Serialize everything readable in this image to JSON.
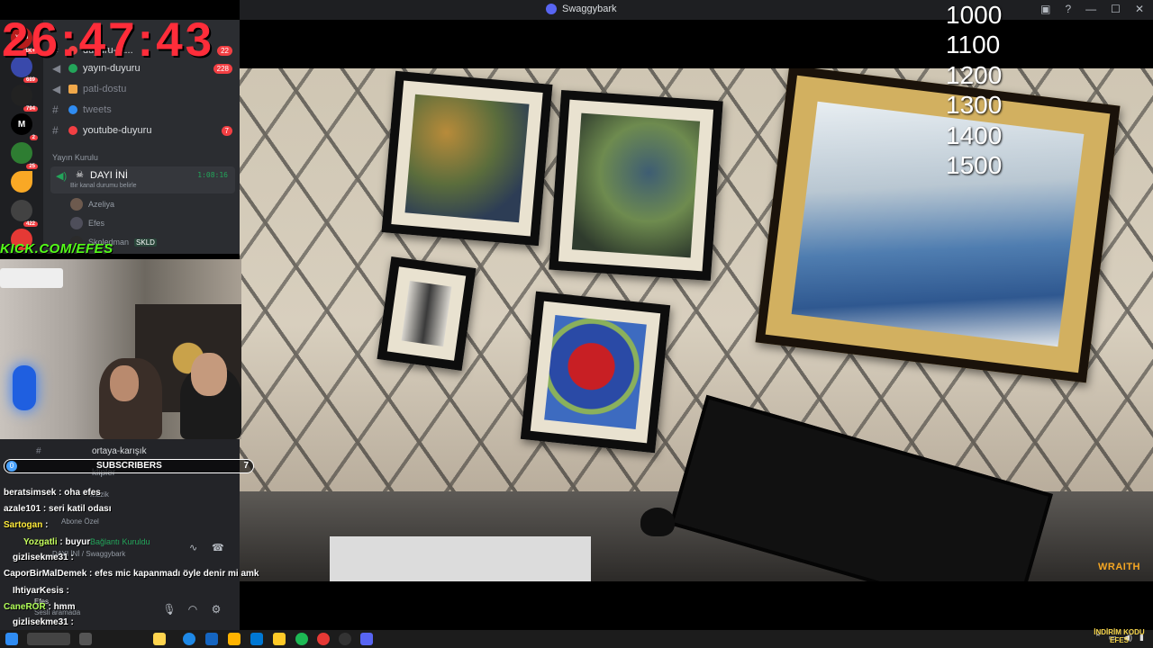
{
  "window": {
    "title": "Swaggybark"
  },
  "overlay": {
    "timer": "26:47:43",
    "goals": [
      "1000",
      "1100",
      "1200",
      "1300",
      "1400",
      "1500"
    ],
    "kick_banner": "KICK.COM/EFES",
    "wraith_label": "WRAITH",
    "indirim": "İNDİRİM KODU EFES"
  },
  "server": {
    "name": "Swaggybark",
    "categories": {
      "broadcast": "Yayın Kurulu"
    },
    "channels": [
      {
        "label": "duyuru-ta...",
        "color": "#f23f43",
        "badge": "22"
      },
      {
        "label": "yayın-duyuru",
        "color": "#23a55a",
        "badge": "228"
      },
      {
        "label": "pati-dostu",
        "color": "#f0a84a",
        "badge": ""
      },
      {
        "label": "tweets",
        "color": "#2f8cf2",
        "badge": ""
      },
      {
        "label": "youtube-duyuru",
        "color": "#f23f43",
        "badge": "7"
      }
    ],
    "voice": {
      "name": "DAYI İNİ",
      "status": "Bir kanal durumu belirle",
      "time": "1:08:16",
      "members": [
        "Azeliya",
        "Efes",
        "Skoledman"
      ],
      "member_tag": "SKLD"
    },
    "server_icons": [
      {
        "label": "YENİ",
        "count": "1K+"
      },
      {
        "label": "",
        "count": "689"
      },
      {
        "label": "",
        "count": "794"
      },
      {
        "label": "M",
        "count": "2"
      },
      {
        "label": "",
        "count": "25"
      },
      {
        "label": "",
        "count": ""
      },
      {
        "label": "",
        "count": "422"
      },
      {
        "label": "",
        "count": ""
      }
    ]
  },
  "lower": {
    "channel": "ortaya-karışık",
    "channel2": "klipler",
    "voice_connected": "Bağlantı Kuruldu",
    "voice_server": "DAYI İNİ / Swaggybark",
    "subscribers_label": "SUBSCRIBERS",
    "subscribers_left": "0",
    "subscribers_count": "7",
    "self_name": "Efes",
    "self_status": "Sesli aramada"
  },
  "chat": [
    {
      "user": "beratsimsek",
      "msg": "oha efes"
    },
    {
      "user": "azale101",
      "msg": "seri katil odası"
    },
    {
      "user": "Sartogan",
      "msg": ""
    },
    {
      "user": "Yozgatli",
      "msg": "buyur"
    },
    {
      "user": "gizlisekme31",
      "msg": ""
    },
    {
      "user": "CaporBirMalDemek",
      "msg": "efes mic kapanmadı öyle denir mi amk"
    },
    {
      "user": "IhtiyarKesis",
      "msg": ""
    },
    {
      "user": "CaneROR",
      "msg": "hmm"
    },
    {
      "user": "gizlisekme31",
      "msg": ""
    }
  ],
  "chat_ghost": {
    "abone": "Abone Özel",
    "muzik": "müzik"
  }
}
